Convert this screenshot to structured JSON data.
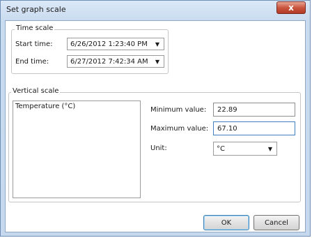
{
  "window": {
    "title": "Set graph scale",
    "close_glyph": "x"
  },
  "time_scale": {
    "group_label": "Time scale",
    "start_label": "Start time:",
    "start_value": "6/26/2012 1:23:40 PM",
    "end_label": "End time:",
    "end_value": "6/27/2012 7:42:34 AM"
  },
  "vertical_scale": {
    "group_label": "Vertical scale",
    "series": [
      "Temperature (°C)"
    ],
    "min_label": "Minimum value:",
    "min_value": "22.89",
    "max_label": "Maximum value:",
    "max_value": "67.10",
    "unit_label": "Unit:",
    "unit_value": "°C"
  },
  "buttons": {
    "ok": "OK",
    "cancel": "Cancel"
  },
  "icons": {
    "dropdown": "chevron-down-icon"
  },
  "colors": {
    "close": "#c9563f",
    "frame": "#c9dbef"
  }
}
